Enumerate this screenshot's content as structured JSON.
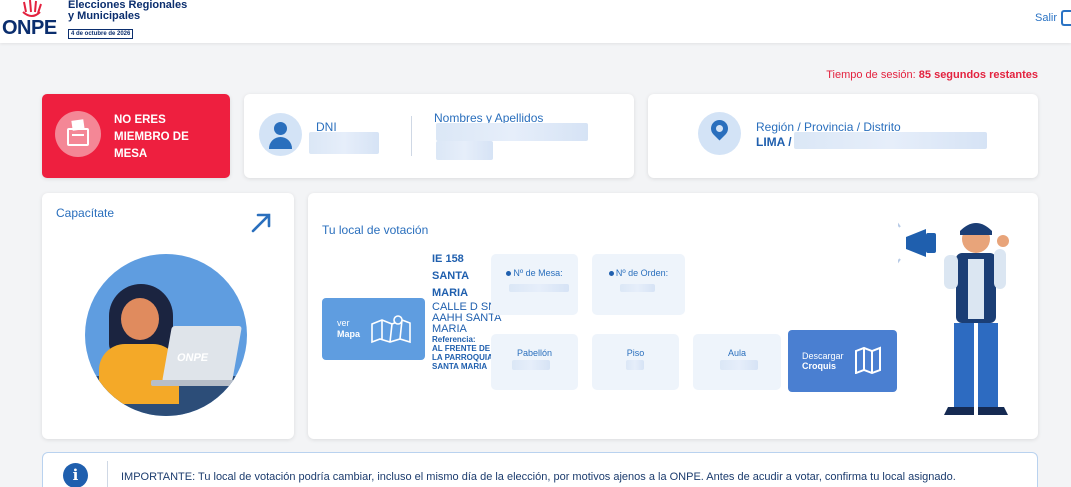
{
  "header": {
    "logo_text": "ONPE",
    "brand_line1": "Elecciones Regionales",
    "brand_line2": "y Municipales",
    "brand_date": "4 de octubre de 2026",
    "logout_label": "Salir"
  },
  "session": {
    "label": "Tiempo de sesión:",
    "remaining": "85 segundos restantes"
  },
  "alert_card": {
    "message": "NO ERES MIEMBRO DE MESA",
    "icon": "ballot-box-icon"
  },
  "identity": {
    "dni_label": "DNI",
    "names_label": "Nombres y Apellidos"
  },
  "location": {
    "label": "Región / Provincia / Distrito",
    "value_prefix": "LIMA /"
  },
  "training": {
    "title": "Capacítate",
    "laptop_brand": "ONPE"
  },
  "voting": {
    "title": "Tu local de votación",
    "map_button": {
      "line1": "ver",
      "line2": "Mapa"
    },
    "school_name": "IE 158 SANTA MARIA",
    "address": "CALLE D SN AAHH SANTA MARIA",
    "reference_label": "Referencia:",
    "reference": "AL FRENTE DE LA PARROQUIA SANTA MARIA",
    "mesa_label": "Nº de Mesa:",
    "orden_label": "Nº de Orden:",
    "pabellon_label": "Pabellón",
    "piso_label": "Piso",
    "aula_label": "Aula",
    "croquis_button": {
      "line1": "Descargar",
      "line2": "Croquis"
    }
  },
  "notice": {
    "text": "IMPORTANTE: Tu local de votación podría cambiar, incluso el mismo día de la elección, por motivos ajenos a la ONPE. Antes de acudir a votar, confirma tu local asignado."
  },
  "colors": {
    "brand_blue": "#0b2e6e",
    "accent_blue": "#2a6fbd",
    "alert_red": "#ee1f3f"
  }
}
